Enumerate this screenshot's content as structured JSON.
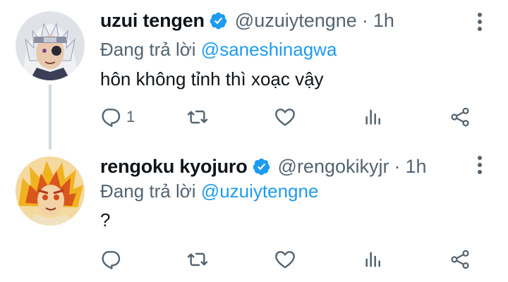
{
  "tweets": [
    {
      "display_name": "uzui tengen",
      "handle": "@uzuiytengne",
      "separator": "·",
      "time": "1h",
      "reply_prefix": "Đang trả lời",
      "reply_mention": "@saneshinagwa",
      "text": "hôn không tỉnh thì xoạc vậy",
      "reply_count": "1",
      "verified": true
    },
    {
      "display_name": "rengoku kyojuro",
      "handle": "@rengokikyjr",
      "separator": "·",
      "time": "1h",
      "reply_prefix": "Đang trả lời",
      "reply_mention": "@uzuiytengne",
      "text": "?",
      "reply_count": "",
      "verified": true
    }
  ],
  "colors": {
    "accent": "#1d9bf0",
    "secondary_text": "#536471",
    "primary_text": "#0f1419",
    "thread_line": "#cfd9de"
  },
  "icons": [
    "verified-badge-icon",
    "more-vertical-icon",
    "reply-icon",
    "retweet-icon",
    "like-icon",
    "analytics-icon",
    "share-icon"
  ]
}
